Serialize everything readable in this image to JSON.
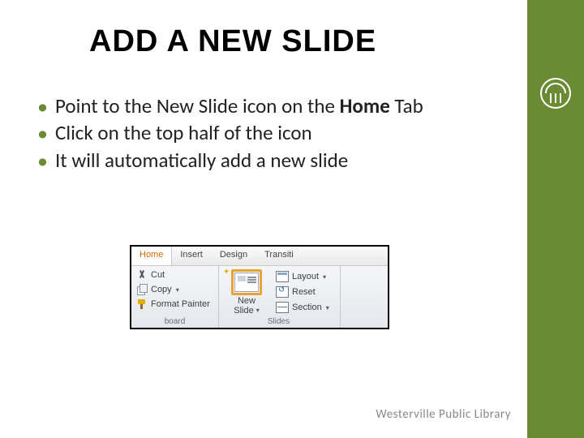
{
  "title": "ADD A NEW SLIDE",
  "bullets": [
    {
      "pre": "Point to the New Slide icon on the ",
      "bold": "Home",
      "post": " Tab"
    },
    {
      "pre": "Click on the top half of the icon",
      "bold": "",
      "post": ""
    },
    {
      "pre": "It will automatically add a new slide",
      "bold": "",
      "post": ""
    }
  ],
  "ribbon": {
    "tabs": [
      "Home",
      "Insert",
      "Design",
      "Transiti"
    ],
    "active_tab_index": 0,
    "clipboard": {
      "items": [
        "Cut",
        "Copy",
        "Format Painter"
      ],
      "group_label": "board"
    },
    "slides": {
      "new_slide_line1": "New",
      "new_slide_line2": "Slide",
      "options": [
        "Layout",
        "Reset",
        "Section"
      ],
      "group_label": "Slides"
    }
  },
  "footer": "Westerville Public Library"
}
